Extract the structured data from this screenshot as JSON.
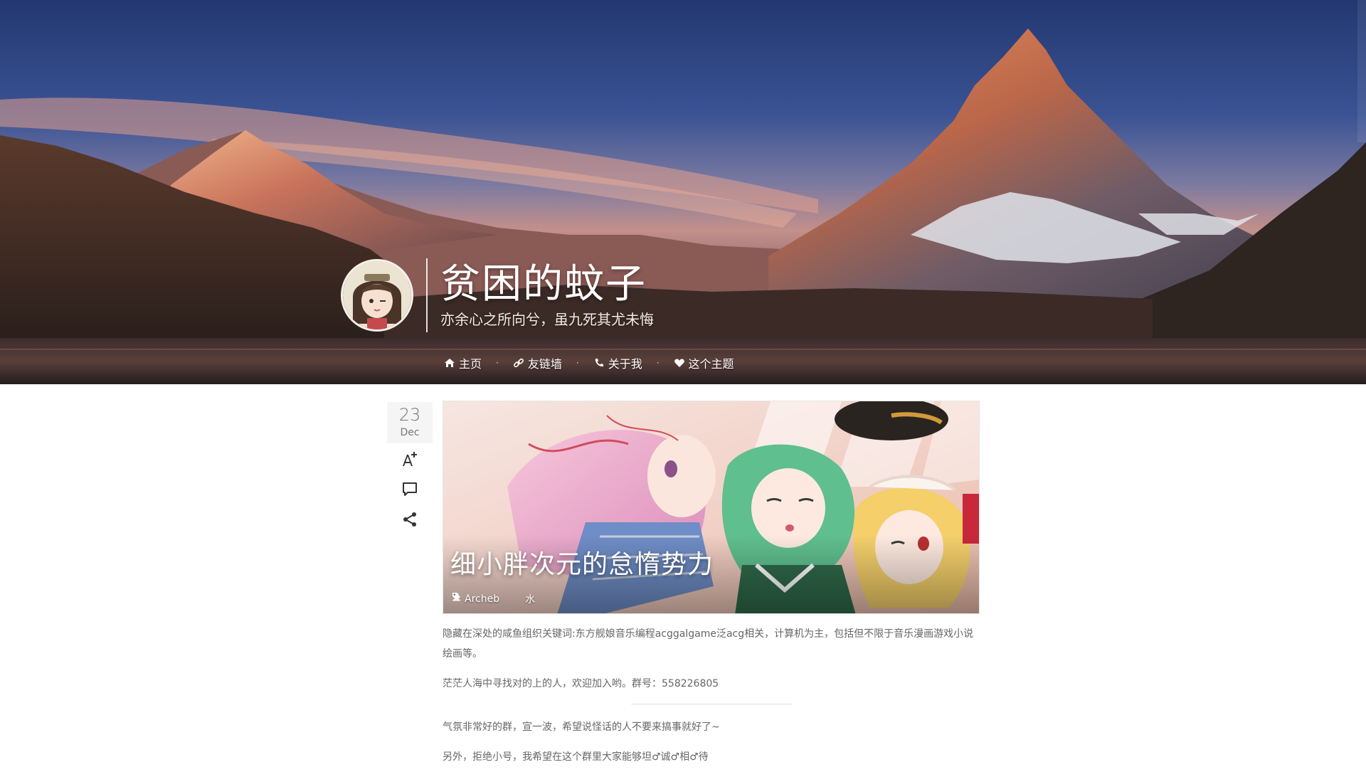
{
  "site": {
    "title": "贫困的蚊子",
    "subtitle": "亦余心之所向兮，虽九死其尤未悔"
  },
  "nav": {
    "items": [
      {
        "label": "主页",
        "icon": "home-icon"
      },
      {
        "label": "友链墙",
        "icon": "link-icon"
      },
      {
        "label": "关于我",
        "icon": "phone-icon"
      },
      {
        "label": "这个主题",
        "icon": "heart-icon"
      }
    ],
    "separator": "·"
  },
  "post": {
    "date_day": "23",
    "date_month": "Dec",
    "title": "细小胖次元的怠惰势力",
    "author": "Archeb",
    "tag": "水",
    "paragraphs": [
      "隐藏在深处的咸鱼组织关键词:东方舰娘音乐编程acggalgame泛acg相关，计算机为主，包括但不限于音乐漫画游戏小说绘画等。",
      "茫茫人海中寻找对的上的人，欢迎加入哟。群号：558226805",
      "气氛非常好的群，宣一波，希望说怪话的人不要来搞事就好了~",
      "另外，拒绝小号，我希望在这个群里大家能够坦♂诚♂相♂待"
    ]
  },
  "icons": {
    "font_size": "font-size-icon",
    "comment": "comment-icon",
    "share": "share-icon",
    "author": "user-icon",
    "tag": "tag-icon"
  },
  "colors": {
    "sky_top": "#263a73",
    "text": "#666666",
    "date_bg": "#f5f5f5"
  }
}
